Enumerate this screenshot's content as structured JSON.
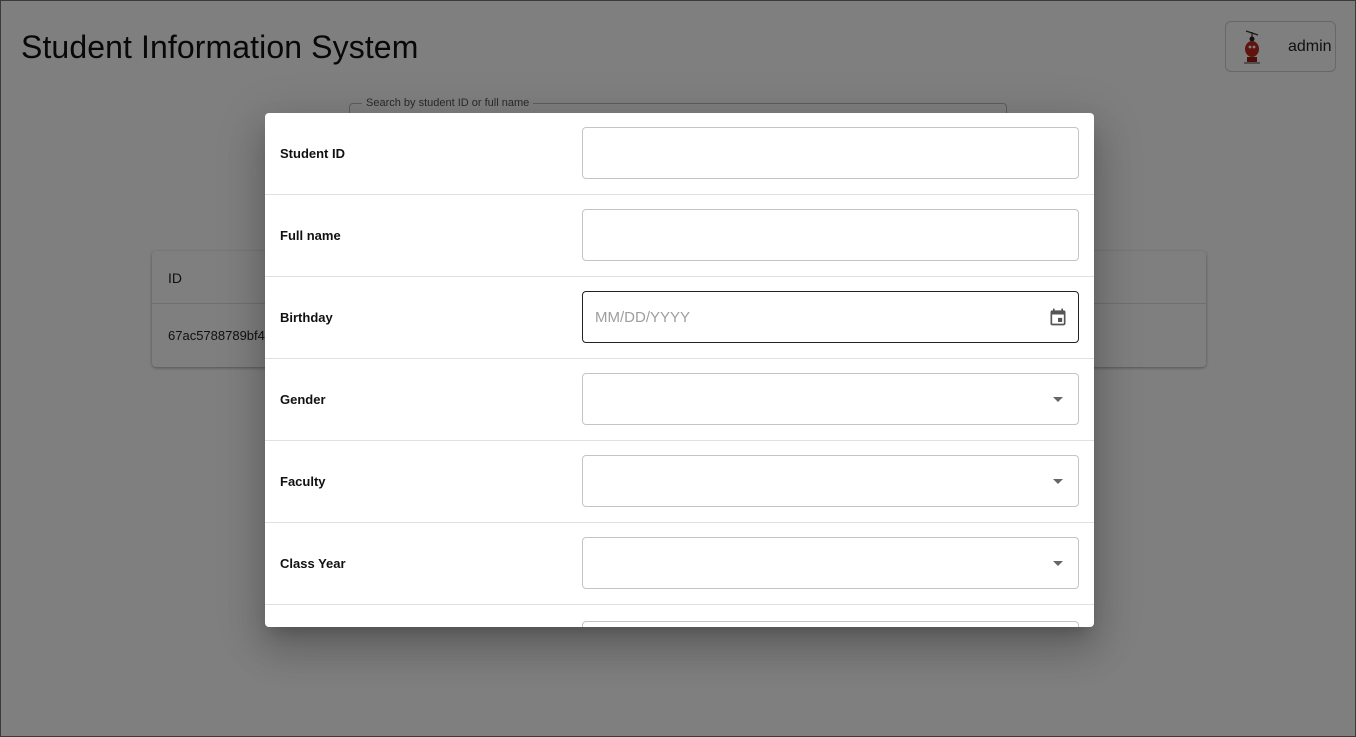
{
  "app": {
    "title": "Student Information System",
    "user": "admin"
  },
  "search": {
    "legend": "Search by student ID or full name"
  },
  "table": {
    "columns": [
      "ID"
    ],
    "rows": [
      [
        "67ac5788789bf4"
      ]
    ]
  },
  "form": {
    "fields": [
      {
        "label": "Student ID",
        "type": "text",
        "value": ""
      },
      {
        "label": "Full name",
        "type": "text",
        "value": ""
      },
      {
        "label": "Birthday",
        "type": "date",
        "placeholder": "MM/DD/YYYY",
        "icon": "calendar-icon"
      },
      {
        "label": "Gender",
        "type": "select",
        "value": "",
        "icon": "dropdown-arrow-icon"
      },
      {
        "label": "Faculty",
        "type": "select",
        "value": "",
        "icon": "dropdown-arrow-icon"
      },
      {
        "label": "Class Year",
        "type": "select",
        "value": "",
        "icon": "dropdown-arrow-icon"
      }
    ]
  },
  "colors": {
    "backdrop": "rgba(0,0,0,0.5)",
    "focused_border": "#222222",
    "field_border": "#c4c4c4"
  }
}
